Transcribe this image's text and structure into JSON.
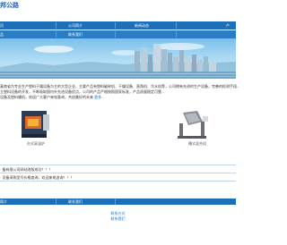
{
  "header": {
    "logo_text": "邦公路"
  },
  "nav_primary": [
    {
      "label": "页"
    },
    {
      "label": "公司简介"
    },
    {
      "label": "新闻动态"
    },
    {
      "label": "产"
    }
  ],
  "nav_secondary": [
    {
      "label": "品"
    },
    {
      "label": "联系我们"
    }
  ],
  "intro": {
    "line1": "真南省为专业生产塑料干燥设备为主的大型企业，主要产品有塑料破碎机、干燥设备、直角机、冷水机等，公司拥有先进的生产设备，完善的检测手段...",
    "line2": "立塑料设备的开发，不断吸取国内外先进设备优点，公司的产品严格按照国家标准，产品质量稳定可靠...",
    "line3": "设备及塑料辅机，欢迎广大客户来电垂询，共创美好的未来",
    "more_link": "更多..."
  },
  "products": [
    {
      "caption": "台式高温炉"
    },
    {
      "caption": "槽式混合机"
    }
  ],
  "news": [
    {
      "text": "· 备有限公司网站改版成功！！！"
    },
    {
      "text": "· 设备采购型号价格查询，欢迎来电咨询！！！"
    }
  ],
  "footer_nav": [
    {
      "label": "简介"
    },
    {
      "label": "联系我们"
    }
  ],
  "footer": {
    "company": "联系方式",
    "link": "联系我们"
  },
  "colors": {
    "nav_bg": "#1d70b7",
    "brand_blue": "#1f63b0",
    "sky": "#7cc0ea"
  }
}
